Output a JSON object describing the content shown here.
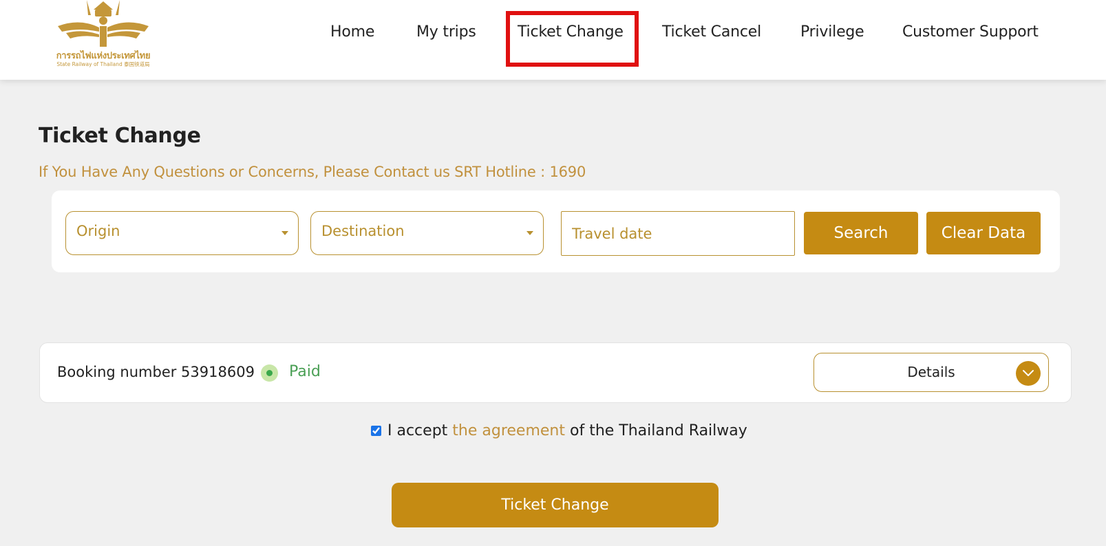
{
  "header": {
    "logo": {
      "thai_text": "การรถไฟแห่งประเทศไทย",
      "english_text": "State Railway of Thailand 泰国铁道局"
    },
    "nav": [
      {
        "label": "Home",
        "active": false
      },
      {
        "label": "My trips",
        "active": false
      },
      {
        "label": "Ticket Change",
        "active": true
      },
      {
        "label": "Ticket Cancel",
        "active": false
      },
      {
        "label": "Privilege",
        "active": false
      },
      {
        "label": "Customer Support",
        "active": false
      }
    ]
  },
  "main": {
    "title": "Ticket Change",
    "hotline_text": "If You Have Any Questions or Concerns, Please Contact us SRT Hotline : 1690",
    "search": {
      "origin_placeholder": "Origin",
      "destination_placeholder": "Destination",
      "travel_date_placeholder": "Travel date",
      "search_label": "Search",
      "clear_label": "Clear Data"
    },
    "booking": {
      "label": "Booking number 53918609",
      "status": "Paid",
      "details_label": "Details"
    },
    "agreement": {
      "checked": true,
      "prefix": "I accept",
      "link": "the agreement",
      "suffix": "of the Thailand Railway"
    },
    "submit_label": "Ticket Change"
  },
  "colors": {
    "accent_gold": "#c58b13",
    "text_gold": "#c1913e",
    "status_green": "#4a9f55",
    "highlight_red": "#e01010",
    "background": "#f0f0f0"
  }
}
